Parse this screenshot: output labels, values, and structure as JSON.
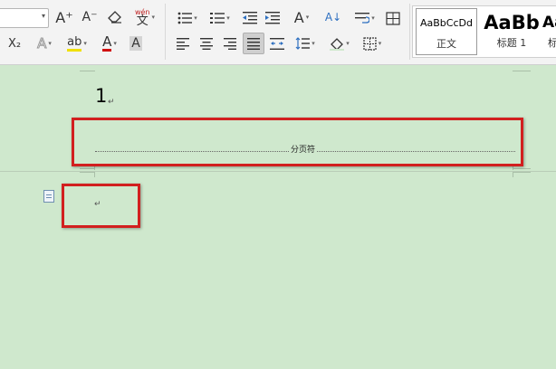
{
  "ribbon": {
    "font_size": {
      "value": "",
      "dropdown": "▾"
    },
    "font_buttons": {
      "grow_font": "A⁺",
      "shrink_font": "A⁻",
      "clear_format": "◇",
      "phonetic_top": "wén",
      "phonetic_char": "文",
      "subscript": "X₂",
      "text_effect": "A",
      "highlight": "ab",
      "font_color": "A",
      "char_shading": "A"
    },
    "paragraph_buttons": {
      "chinese_layout": "A",
      "sort": "A↓",
      "line_spacing": "↕"
    },
    "styles": [
      {
        "preview": "AaBbCcDd",
        "caption": "正文"
      },
      {
        "preview": "AaBb",
        "caption": "标题 1"
      },
      {
        "preview": "Aa",
        "caption": "标"
      }
    ]
  },
  "document": {
    "page_number_text": "1",
    "paragraph_mark": "↵",
    "page_break_label": "分页符",
    "new_page_paragraph_mark": "↵"
  }
}
